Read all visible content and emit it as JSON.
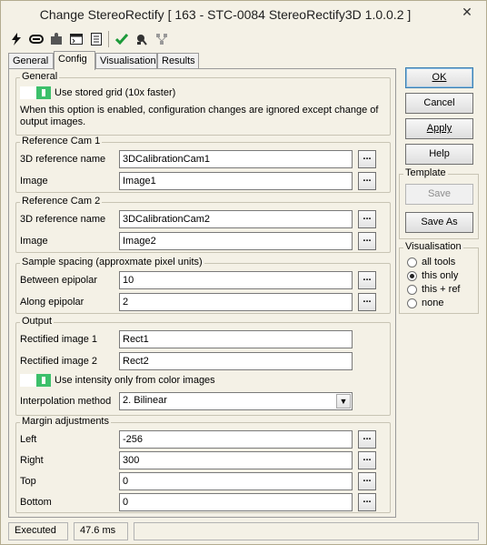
{
  "window": {
    "title": "Change StereoRectify [ 163 - STC-0084 StereoRectify3D 1.0.0.2 ]",
    "close_glyph": "✕"
  },
  "toolbar": {
    "icons": [
      "lightning-icon",
      "link-icon",
      "puzzle-icon",
      "console-icon",
      "document-icon",
      "checkmark-icon",
      "run-icon",
      "network-icon"
    ]
  },
  "tabs": [
    {
      "label": "General",
      "active": false
    },
    {
      "label": "Config",
      "active": true
    },
    {
      "label": "Visualisation",
      "active": false
    },
    {
      "label": "Results",
      "active": false
    }
  ],
  "general": {
    "title": "General",
    "toggle_label": "Use stored grid (10x faster)",
    "note_line1": "When this option is enabled, configuration changes are ignored except change of",
    "note_line2": "output images."
  },
  "ref_cam1": {
    "title": "Reference Cam 1",
    "ref_label": "3D reference name",
    "ref_value": "3DCalibrationCam1",
    "image_label": "Image",
    "image_value": "Image1"
  },
  "ref_cam2": {
    "title": "Reference Cam 2",
    "ref_label": "3D reference name",
    "ref_value": "3DCalibrationCam2",
    "image_label": "Image",
    "image_value": "Image2"
  },
  "sample": {
    "title": "Sample spacing (approxmate pixel units)",
    "between_label": "Between epipolar",
    "between_value": "10",
    "along_label": "Along epipolar",
    "along_value": "2"
  },
  "output": {
    "title": "Output",
    "rect1_label": "Rectified image 1",
    "rect1_value": "Rect1",
    "rect2_label": "Rectified image 2",
    "rect2_value": "Rect2",
    "intensity_label": "Use intensity only from color images",
    "interp_label": "Interpolation method",
    "interp_value": "2. Bilinear"
  },
  "margin": {
    "title": "Margin adjustments",
    "left_label": "Left",
    "left_value": "-256",
    "right_label": "Right",
    "right_value": "300",
    "top_label": "Top",
    "top_value": "0",
    "bottom_label": "Bottom",
    "bottom_value": "0"
  },
  "dots_label": "...",
  "buttons": {
    "ok": "OK",
    "cancel": "Cancel",
    "apply": "Apply",
    "help": "Help"
  },
  "template": {
    "title": "Template",
    "save": "Save",
    "save_as": "Save As"
  },
  "visualisation": {
    "title": "Visualisation",
    "options": [
      {
        "label": "all tools",
        "selected": false
      },
      {
        "label": "this only",
        "selected": true
      },
      {
        "label": "this + ref",
        "selected": false
      },
      {
        "label": "none",
        "selected": false
      }
    ]
  },
  "status": {
    "state": "Executed",
    "time": "47.6 ms"
  }
}
